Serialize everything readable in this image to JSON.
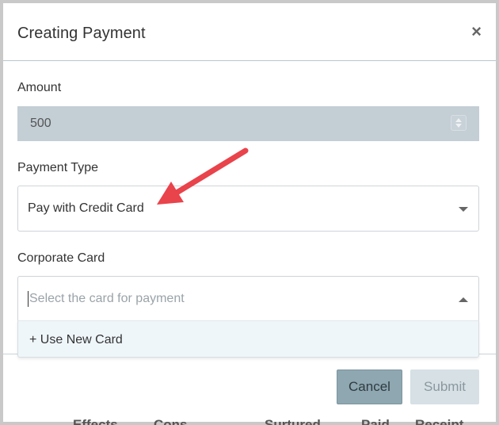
{
  "dialog": {
    "title": "Creating Payment",
    "close_label": "×"
  },
  "form": {
    "amount": {
      "label": "Amount",
      "value": "500"
    },
    "payment_type": {
      "label": "Payment Type",
      "value": "Pay with Credit Card"
    },
    "corporate_card": {
      "label": "Corporate Card",
      "placeholder": "Select the card for payment",
      "options": [
        "+ Use New Card"
      ]
    }
  },
  "buttons": {
    "cancel": "Cancel",
    "submit": "Submit"
  },
  "backdrop_text": [
    "Effects",
    "Cons",
    "Surtured",
    "Paid",
    "Receipt"
  ],
  "colors": {
    "annotation_arrow": "#e9434b",
    "amount_field_bg": "#c3ced5",
    "cancel_button": "#8ea7b1",
    "submit_button_disabled": "#d6e0e5",
    "dropdown_bg": "#eff6fa"
  },
  "icons": {
    "close": "close-icon",
    "amount_spinner": "spinner-icon",
    "payment_type_caret": "chevron-down-icon",
    "corporate_card_caret": "chevron-up-icon",
    "annotation": "red-arrow-annotation"
  }
}
